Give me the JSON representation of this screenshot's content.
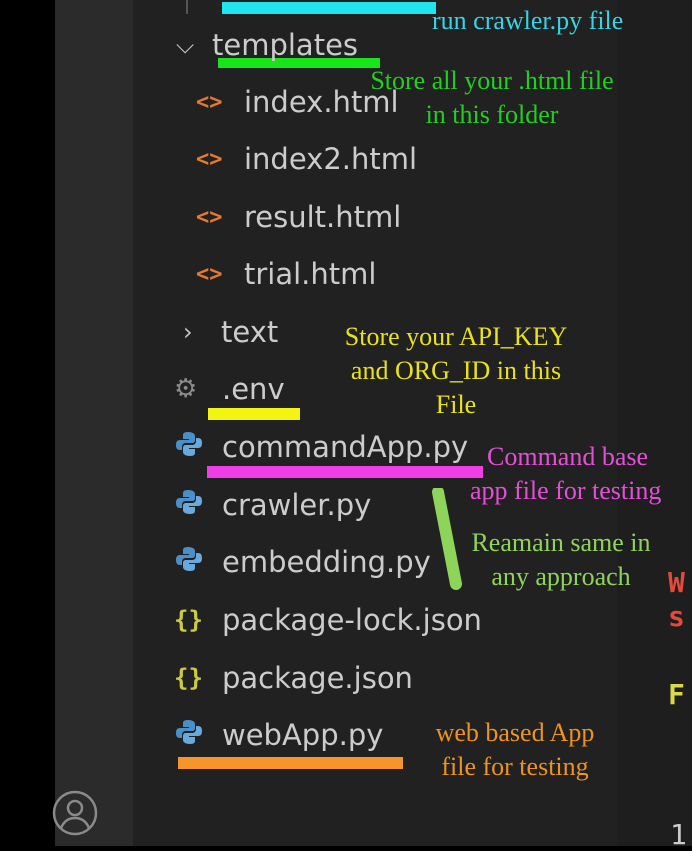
{
  "tree": [
    {
      "type": "folder",
      "expanded": true,
      "name": "templates",
      "icon": "chevron-down-icon"
    },
    {
      "type": "file",
      "name": "index.html",
      "icon": "html-file-icon",
      "glyph": "<>"
    },
    {
      "type": "file",
      "name": "index2.html",
      "icon": "html-file-icon",
      "glyph": "<>"
    },
    {
      "type": "file",
      "name": "result.html",
      "icon": "html-file-icon",
      "glyph": "<>"
    },
    {
      "type": "file",
      "name": "trial.html",
      "icon": "html-file-icon",
      "glyph": "<>"
    },
    {
      "type": "folder",
      "expanded": false,
      "name": "text",
      "icon": "chevron-right-icon"
    },
    {
      "type": "file",
      "name": ".env",
      "icon": "gear-icon",
      "glyph": "⚙"
    },
    {
      "type": "file",
      "name": "commandApp.py",
      "icon": "python-file-icon"
    },
    {
      "type": "file",
      "name": "crawler.py",
      "icon": "python-file-icon"
    },
    {
      "type": "file",
      "name": "embedding.py",
      "icon": "python-file-icon"
    },
    {
      "type": "file",
      "name": "package-lock.json",
      "icon": "json-file-icon",
      "glyph": "{}"
    },
    {
      "type": "file",
      "name": "package.json",
      "icon": "json-file-icon",
      "glyph": "{}"
    },
    {
      "type": "file",
      "name": "webApp.py",
      "icon": "python-file-icon"
    }
  ],
  "annotations": {
    "crawler_top": "run crawler.py file",
    "templates_note_1": "Store all your .html file",
    "templates_note_2": "in this folder",
    "env_note_1": "Store your API_KEY",
    "env_note_2": "and ORG_ID in this",
    "env_note_3": "File",
    "command_note_1": "Command base",
    "command_note_2": "app file for testing",
    "same_note_1": "Reamain same in",
    "same_note_2": "any approach",
    "web_note_1": "web based App",
    "web_note_2": "file for testing"
  },
  "colors": {
    "cyan": "#22e4f0",
    "green": "#19e619",
    "yellow": "#f4f412",
    "magenta": "#f03ee6",
    "lime": "#8fd45a",
    "orange": "#f7952a",
    "ann_cyan": "#35d4e6",
    "ann_green": "#1fd11f",
    "ann_yellow": "#e8e21a",
    "ann_magenta": "#e64ed8",
    "ann_lime": "#8fd45a",
    "ann_orange": "#f0921e"
  },
  "editor_peek": {
    "w": "W",
    "s": "s",
    "f": "F",
    "one": "1"
  },
  "activity_bar": {
    "account_icon": "account-icon"
  }
}
